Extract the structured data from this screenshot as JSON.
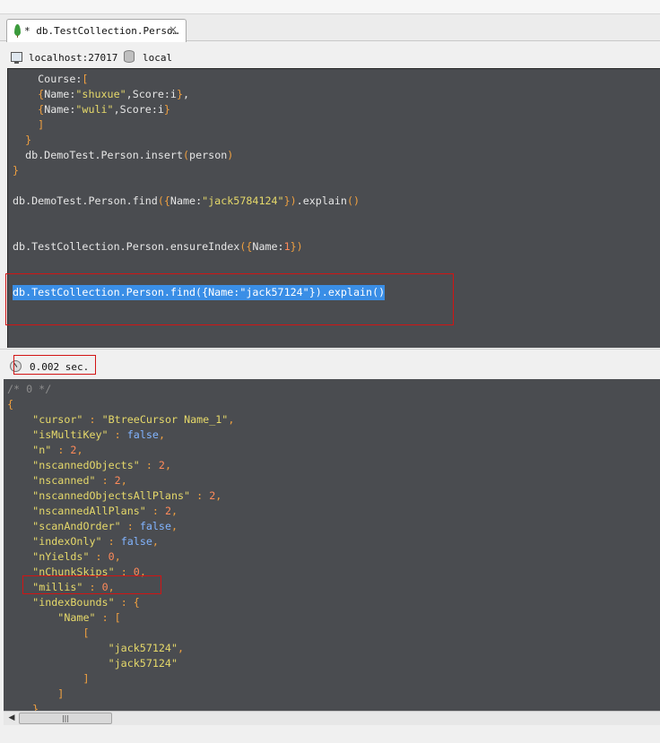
{
  "tab": {
    "label": "* db.TestCollection.Perso…",
    "close": "×"
  },
  "connection": {
    "host": "localhost:27017",
    "database": "local"
  },
  "editor": {
    "lines": [
      {
        "text": "    Course:["
      },
      {
        "text": "    {Name:\"shuxue\",Score:i},"
      },
      {
        "text": "    {Name:\"wuli\",Score:i}"
      },
      {
        "text": "    ]"
      },
      {
        "text": "  }"
      },
      {
        "text": "  db.DemoTest.Person.insert(person)"
      },
      {
        "text": "}"
      },
      {
        "text": "db.DemoTest.Person.find({Name:\"jack5784124\"}).explain()"
      },
      {
        "text": "db.TestCollection.Person.ensureIndex({Name:1})"
      },
      {
        "text": "db.TestCollection.Person.find({Name:\"jack57124\"}).explain()"
      }
    ]
  },
  "status": {
    "elapsed": "0.002 sec."
  },
  "results": {
    "lines": [
      "/* 0 */",
      "{",
      "    \"cursor\" : \"BtreeCursor Name_1\",",
      "    \"isMultiKey\" : false,",
      "    \"n\" : 2,",
      "    \"nscannedObjects\" : 2,",
      "    \"nscanned\" : 2,",
      "    \"nscannedObjectsAllPlans\" : 2,",
      "    \"nscannedAllPlans\" : 2,",
      "    \"scanAndOrder\" : false,",
      "    \"indexOnly\" : false,",
      "    \"nYields\" : 0,",
      "    \"nChunkSkips\" : 0,",
      "    \"millis\" : 0,",
      "    \"indexBounds\" : {",
      "        \"Name\" : [",
      "            [",
      "                \"jack57124\",",
      "                \"jack57124\"",
      "            ]",
      "        ]",
      "    },"
    ]
  },
  "scrollbar": {
    "left_arrow": "◀",
    "thumb_grip": "|||"
  },
  "colors": {
    "editor_bg": "#4a4c50",
    "selection": "#3a8ee6",
    "string": "#e6d96a",
    "punctuation": "#f0a040",
    "keyword": "#82b4ff",
    "number": "#ff8a5a",
    "highlight_box": "#d21414"
  },
  "icons": {
    "tab": "mongodb-leaf-icon",
    "connection": "monitor-icon",
    "database": "database-icon",
    "status": "clock-icon"
  }
}
